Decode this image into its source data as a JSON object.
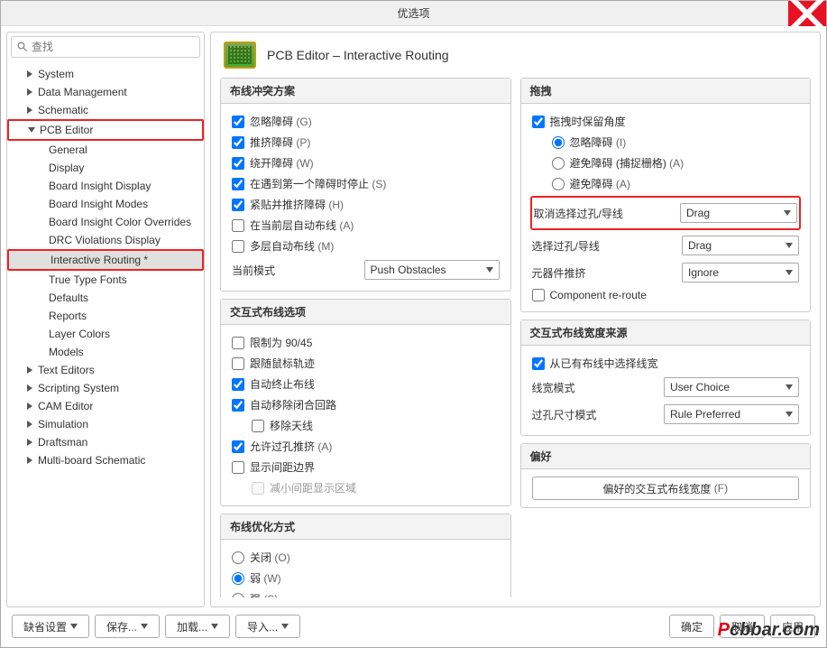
{
  "title": "优选项",
  "search_placeholder": "查找",
  "tree": {
    "system": "System",
    "data_mgmt": "Data Management",
    "schematic": "Schematic",
    "pcb_editor": "PCB Editor",
    "general": "General",
    "display": "Display",
    "bi_display": "Board Insight Display",
    "bi_modes": "Board Insight Modes",
    "bi_color": "Board Insight Color Overrides",
    "drc": "DRC Violations Display",
    "interactive": "Interactive Routing *",
    "ttf": "True Type Fonts",
    "defaults": "Defaults",
    "reports": "Reports",
    "layer_colors": "Layer Colors",
    "models": "Models",
    "text_editors": "Text Editors",
    "scripting": "Scripting System",
    "cam": "CAM Editor",
    "simulation": "Simulation",
    "draftsman": "Draftsman",
    "multiboard": "Multi-board Schematic"
  },
  "page_title": "PCB Editor – Interactive Routing",
  "groups": {
    "conflict": {
      "title": "布线冲突方案",
      "ignore": "忽略障碍",
      "ignore_k": "(G)",
      "push": "推挤障碍",
      "push_k": "(P)",
      "walk": "绕开障碍",
      "walk_k": "(W)",
      "stop": "在遇到第一个障碍时停止",
      "stop_k": "(S)",
      "hug": "紧贴并推挤障碍",
      "hug_k": "(H)",
      "auto_cur": "在当前层自动布线",
      "auto_cur_k": "(A)",
      "auto_multi": "多层自动布线",
      "auto_multi_k": "(M)",
      "mode_label": "当前模式",
      "mode_value": "Push Obstacles"
    },
    "interactive_opts": {
      "title": "交互式布线选项",
      "restrict": "限制为 90/45",
      "follow": "跟随鼠标轨迹",
      "auto_term": "自动终止布线",
      "auto_remove": "自动移除闭合回路",
      "remove_ant": "移除天线",
      "allow_via": "允许过孔推挤",
      "allow_via_k": "(A)",
      "show_clear": "显示间距边界",
      "reduce": "减小间距显示区域"
    },
    "gloss": {
      "title": "布线优化方式",
      "off": "关闭",
      "off_k": "(O)",
      "weak": "弱",
      "weak_k": "(W)",
      "strong": "强",
      "strong_k": "(S)"
    },
    "drag": {
      "title": "拖拽",
      "preserve": "拖拽时保留角度",
      "ignore": "忽略障碍",
      "ignore_k": "(I)",
      "avoid_snap": "避免障碍 (捕捉栅格)",
      "avoid_snap_k": "(A)",
      "avoid": "避免障碍",
      "avoid_k": "(A)",
      "unsel_label": "取消选择过孔/导线",
      "unsel_value": "Drag",
      "sel_label": "选择过孔/导线",
      "sel_value": "Drag",
      "comp_label": "元器件推挤",
      "comp_value": "Ignore",
      "reroute": "Component re-route"
    },
    "width_src": {
      "title": "交互式布线宽度来源",
      "pick": "从已有布线中选择线宽",
      "width_mode_label": "线宽模式",
      "width_mode_value": "User Choice",
      "via_mode_label": "过孔尺寸模式",
      "via_mode_value": "Rule Preferred"
    },
    "fav": {
      "title": "偏好",
      "btn": "偏好的交互式布线宽度",
      "btn_k": "(F)"
    }
  },
  "footer": {
    "defaults": "缺省设置",
    "save": "保存...",
    "load": "加载...",
    "import": "导入...",
    "ok": "确定",
    "cancel": "取消",
    "apply": "应用"
  },
  "watermark": {
    "p": "P",
    "rest": "cbbar.com"
  }
}
